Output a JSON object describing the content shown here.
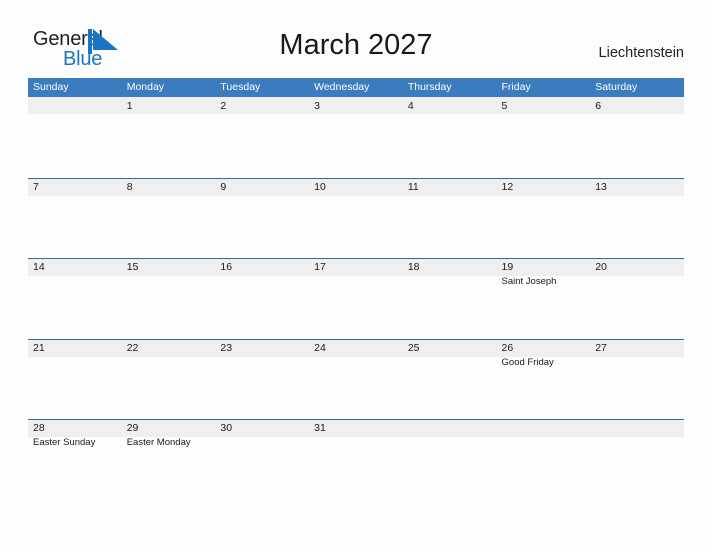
{
  "brand": {
    "name_part1": "General",
    "name_part2": "Blue",
    "flag_icon": "flag-triangle-icon",
    "accent_color": "#1a76c4"
  },
  "header": {
    "title": "March 2027",
    "country": "Liechtenstein",
    "month": "March",
    "year": "2027"
  },
  "theme": {
    "header_blue": "#3a7cbe",
    "band_gray": "#efefef",
    "divider_blue": "#2e6da4",
    "page_background": "#fdfdfd",
    "text_color": "#1a1a1a"
  },
  "calendar": {
    "weekday_headers": [
      "Sunday",
      "Monday",
      "Tuesday",
      "Wednesday",
      "Thursday",
      "Friday",
      "Saturday"
    ],
    "weeks": [
      [
        {
          "num": "",
          "event": ""
        },
        {
          "num": "1",
          "event": ""
        },
        {
          "num": "2",
          "event": ""
        },
        {
          "num": "3",
          "event": ""
        },
        {
          "num": "4",
          "event": ""
        },
        {
          "num": "5",
          "event": ""
        },
        {
          "num": "6",
          "event": ""
        }
      ],
      [
        {
          "num": "7",
          "event": ""
        },
        {
          "num": "8",
          "event": ""
        },
        {
          "num": "9",
          "event": ""
        },
        {
          "num": "10",
          "event": ""
        },
        {
          "num": "11",
          "event": ""
        },
        {
          "num": "12",
          "event": ""
        },
        {
          "num": "13",
          "event": ""
        }
      ],
      [
        {
          "num": "14",
          "event": ""
        },
        {
          "num": "15",
          "event": ""
        },
        {
          "num": "16",
          "event": ""
        },
        {
          "num": "17",
          "event": ""
        },
        {
          "num": "18",
          "event": ""
        },
        {
          "num": "19",
          "event": "Saint Joseph"
        },
        {
          "num": "20",
          "event": ""
        }
      ],
      [
        {
          "num": "21",
          "event": ""
        },
        {
          "num": "22",
          "event": ""
        },
        {
          "num": "23",
          "event": ""
        },
        {
          "num": "24",
          "event": ""
        },
        {
          "num": "25",
          "event": ""
        },
        {
          "num": "26",
          "event": "Good Friday"
        },
        {
          "num": "27",
          "event": ""
        }
      ],
      [
        {
          "num": "28",
          "event": "Easter Sunday"
        },
        {
          "num": "29",
          "event": "Easter Monday"
        },
        {
          "num": "30",
          "event": ""
        },
        {
          "num": "31",
          "event": ""
        },
        {
          "num": "",
          "event": ""
        },
        {
          "num": "",
          "event": ""
        },
        {
          "num": "",
          "event": ""
        }
      ]
    ]
  }
}
